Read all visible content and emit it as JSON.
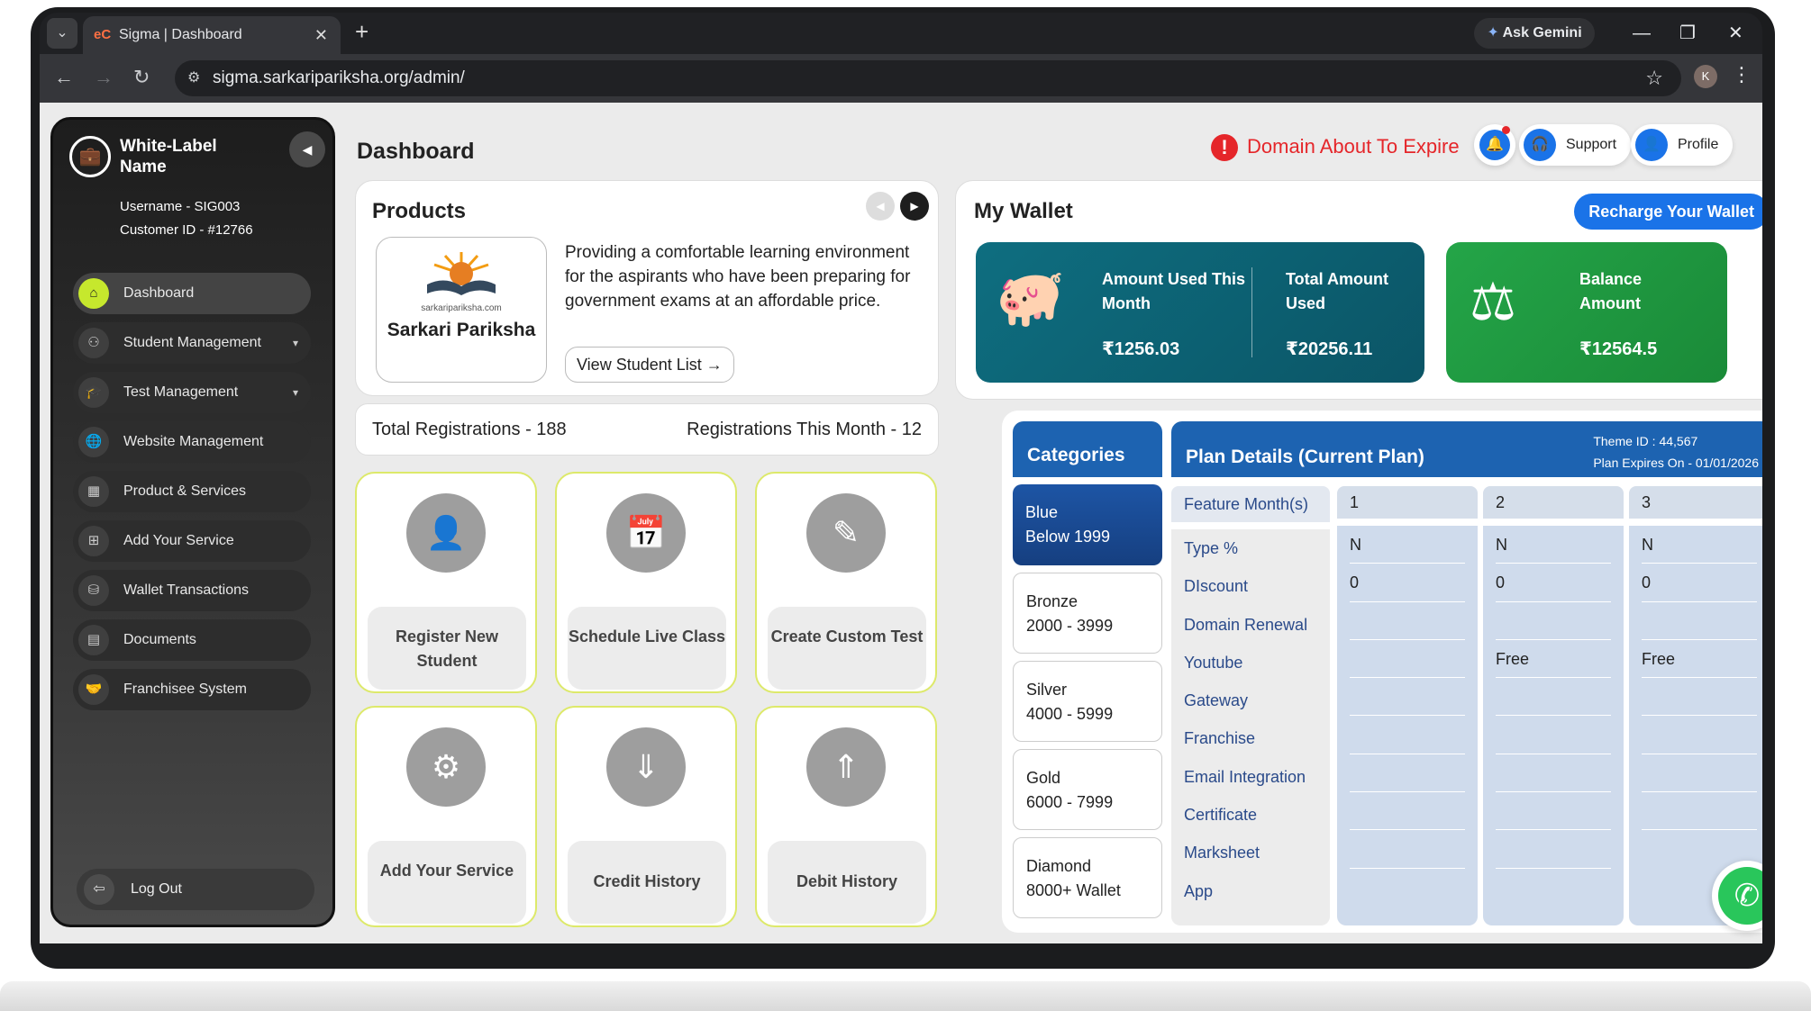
{
  "browser": {
    "tab_title": "Sigma | Dashboard",
    "tab_favicon": "eC",
    "url": "sigma.sarkaripariksha.org/admin/",
    "ask_gemini": "Ask Gemini",
    "profile_initial": "K"
  },
  "sidebar": {
    "brand": "White-Label Name",
    "username": "Username - SIG003",
    "customer_id": "Customer ID - #12766",
    "items": [
      {
        "label": "Dashboard",
        "icon": "home-icon",
        "active": true
      },
      {
        "label": "Student Management",
        "icon": "students-icon",
        "has_submenu": true
      },
      {
        "label": "Test Management",
        "icon": "graduation-cap-icon",
        "has_submenu": true
      },
      {
        "label": "Website Management",
        "icon": "globe-icon"
      },
      {
        "label": "Product & Services",
        "icon": "grid-icon"
      },
      {
        "label": "Add Your Service",
        "icon": "add-service-icon"
      },
      {
        "label": "Wallet Transactions",
        "icon": "wallet-icon"
      },
      {
        "label": "Documents",
        "icon": "document-icon"
      },
      {
        "label": "Franchisee System",
        "icon": "handshake-icon"
      }
    ],
    "logout": "Log Out",
    "accent_color": "#c6e82d"
  },
  "header": {
    "title": "Dashboard",
    "alert": "Domain About To Expire",
    "support": "Support",
    "profile": "Profile"
  },
  "products": {
    "title": "Products",
    "logo_tagline": "sarkaripariksha.com",
    "logo_name": "Sarkari Pariksha",
    "description": "Providing a comfortable learning environment for the aspirants who have been preparing for government exams at an affordable price.",
    "view_button": "View Student List →"
  },
  "registrations": {
    "total": "Total Registrations - 188",
    "this_month": "Registrations This Month - 12"
  },
  "actions": [
    {
      "label": "Register New Student",
      "icon": "add-user-icon"
    },
    {
      "label": "Schedule Live Class",
      "icon": "calendar-clock-icon"
    },
    {
      "label": "Create Custom Test",
      "icon": "edit-icon"
    },
    {
      "label": "Add Your Service",
      "icon": "gears-icon"
    },
    {
      "label": "Credit History",
      "icon": "download-layers-icon"
    },
    {
      "label": "Debit History",
      "icon": "upload-layers-icon"
    }
  ],
  "wallet": {
    "title": "My Wallet",
    "recharge": "Recharge Your Wallet",
    "used_month_label": "Amount Used This Month",
    "used_month_value": "₹1256.03",
    "total_used_label": "Total Amount Used",
    "total_used_value": "₹20256.11",
    "balance_label": "Balance Amount",
    "balance_value": "₹12564.5",
    "teal_color": "#0e6e80",
    "green_color": "#1f9e3c"
  },
  "plan": {
    "categories_title": "Categories",
    "categories": [
      {
        "line1": "Blue",
        "line2": "Below 1999",
        "selected": true
      },
      {
        "line1": "Bronze",
        "line2": "2000 - 3999"
      },
      {
        "line1": "Silver",
        "line2": "4000 - 5999"
      },
      {
        "line1": "Gold",
        "line2": "6000 - 7999"
      },
      {
        "line1": "Diamond",
        "line2": "8000+ Wallet"
      }
    ],
    "details_title": "Plan Details (Current Plan)",
    "theme_id": "Theme ID : 44,567",
    "expires": "Plan Expires On - 01/01/2026",
    "feature_header": "Feature Month(s)",
    "features": [
      "Type %",
      "DIscount",
      "Domain Renewal",
      "Youtube",
      "Gateway",
      "Franchise",
      "Email Integration",
      "Certificate",
      "Marksheet",
      "App"
    ],
    "columns": [
      {
        "header": "1",
        "values": [
          "N",
          "0",
          "",
          "",
          "",
          "",
          "",
          "",
          "",
          ""
        ]
      },
      {
        "header": "2",
        "values": [
          "N",
          "0",
          "",
          "Free",
          "",
          "",
          "",
          "",
          "",
          ""
        ]
      },
      {
        "header": "3",
        "values": [
          "N",
          "0",
          "",
          "Free",
          "",
          "",
          "",
          "",
          "",
          ""
        ]
      }
    ]
  }
}
